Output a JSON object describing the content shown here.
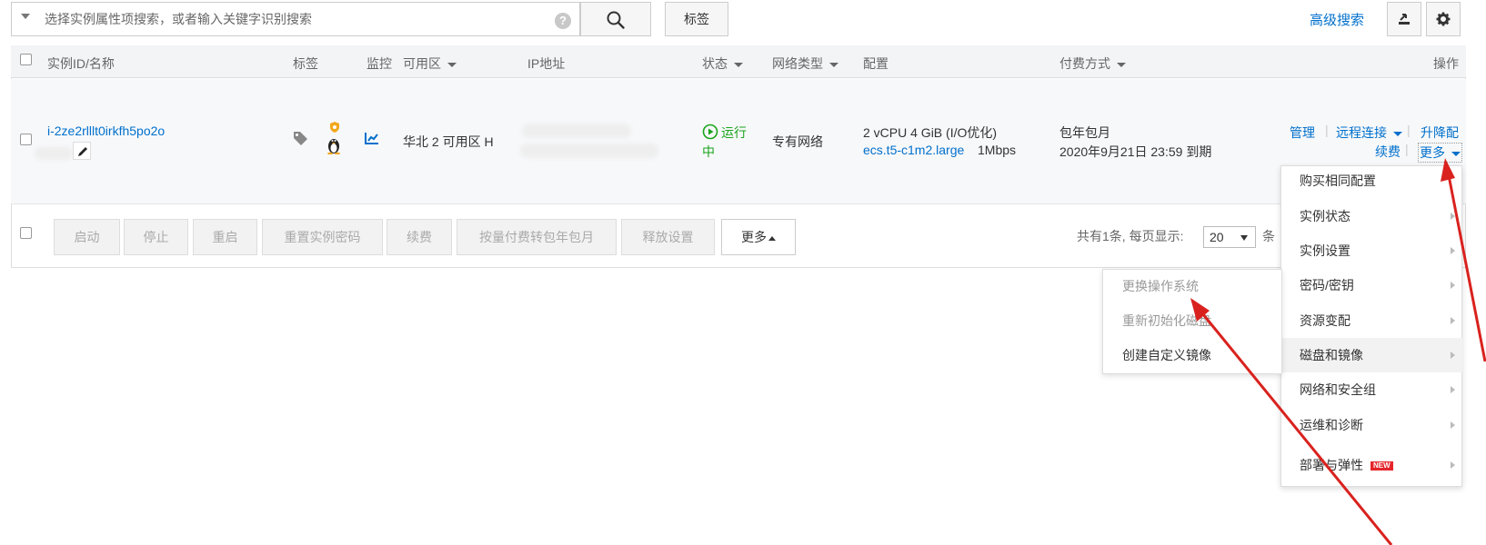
{
  "search": {
    "placeholder": "选择实例属性项搜索，或者输入关键字识别搜索",
    "help_icon": "?",
    "tag_button": "标签",
    "advanced_search": "高级搜索"
  },
  "columns": {
    "instance": "实例ID/名称",
    "tags": "标签",
    "monitor": "监控",
    "zone": "可用区",
    "ip": "IP地址",
    "status": "状态",
    "network": "网络类型",
    "config": "配置",
    "billing": "付费方式",
    "actions": "操作"
  },
  "instance": {
    "id": "i-2ze2rlllt0irkfh5po2o",
    "zone": "华北 2 可用区 H",
    "status_line1": "运行",
    "status_line2": "中",
    "network_type": "专有网络",
    "config_line1": "2 vCPU 4 GiB (I/O优化)",
    "instance_type": "ecs.t5-c1m2.large",
    "bandwidth": "1Mbps",
    "billing_line1": "包年包月",
    "billing_line2": "2020年9月21日 23:59 到期",
    "actions": {
      "manage": "管理",
      "remote": "远程连接",
      "upgrade": "升降配",
      "renew": "续费",
      "more": "更多"
    }
  },
  "bulk_actions": {
    "start": "启动",
    "stop": "停止",
    "restart": "重启",
    "reset_password": "重置实例密码",
    "renew": "续费",
    "convert": "按量付费转包年包月",
    "release": "释放设置",
    "more": "更多"
  },
  "pagination": {
    "summary": "共有1条, 每页显示:",
    "page_size": "20",
    "unit": "条"
  },
  "more_menu": {
    "items": [
      {
        "label": "购买相同配置"
      },
      {
        "label": "实例状态"
      },
      {
        "label": "实例设置"
      },
      {
        "label": "密码/密钥"
      },
      {
        "label": "资源变配"
      },
      {
        "label": "磁盘和镜像"
      },
      {
        "label": "网络和安全组"
      },
      {
        "label": "运维和诊断"
      },
      {
        "label": "部署与弹性"
      }
    ],
    "new_badge": "NEW"
  },
  "submenu": {
    "items": [
      {
        "label": "更换操作系统"
      },
      {
        "label": "重新初始化磁盘"
      },
      {
        "label": "创建自定义镜像"
      }
    ]
  },
  "colors": {
    "link": "#0070cc",
    "running": "#1aa51a",
    "annotation_arrow": "#d9221e"
  }
}
